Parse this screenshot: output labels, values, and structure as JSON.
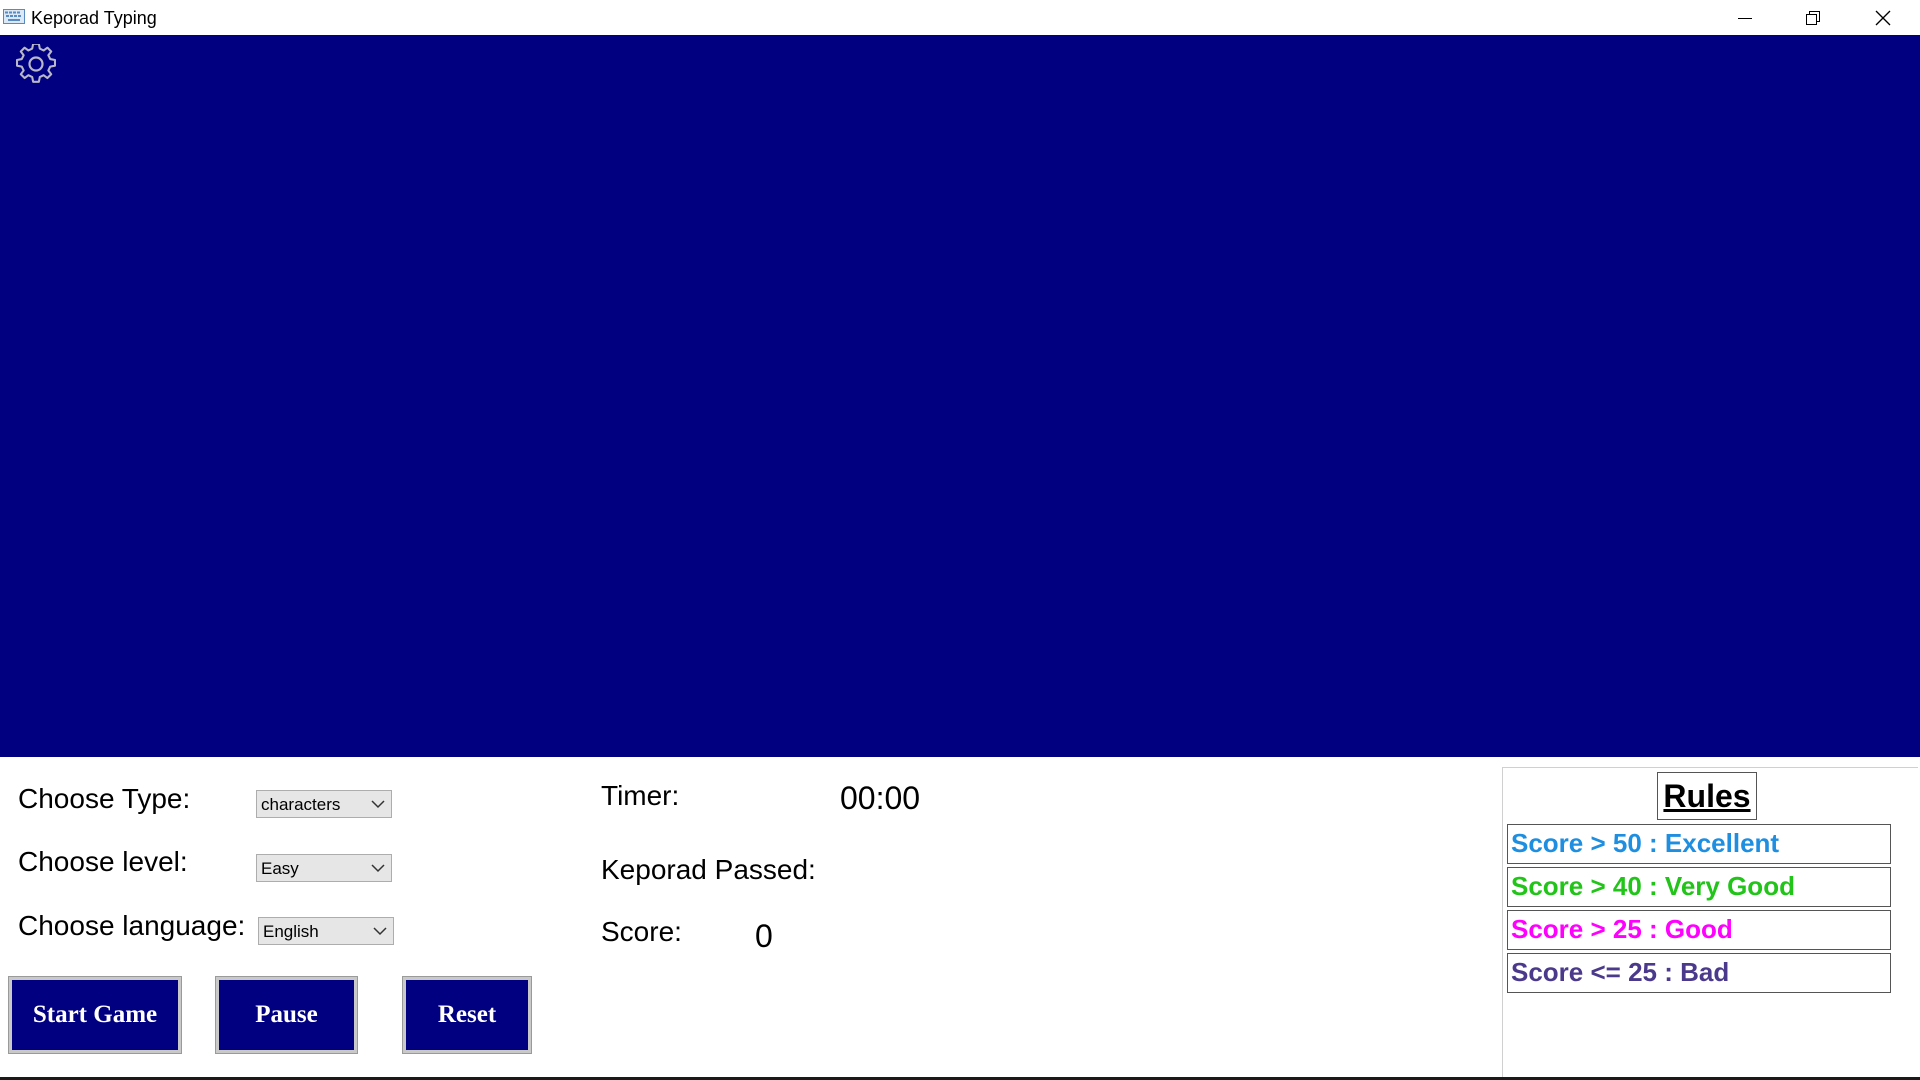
{
  "window": {
    "title": "Keporad Typing",
    "icon": "keyboard-icon"
  },
  "window_controls": {
    "minimize": "minimize-icon",
    "restore": "restore-icon",
    "close": "close-icon"
  },
  "colors": {
    "game_area_bg": "#000080",
    "button_bg": "#000080",
    "rule_excellent": "#1e8ee0",
    "rule_very_good": "#22c41a",
    "rule_good": "#ff00ff",
    "rule_bad": "#4b3a8c"
  },
  "settings": {
    "type_label": "Choose Type:",
    "type_value": "characters",
    "level_label": "Choose level:",
    "level_value": "Easy",
    "language_label": "Choose language:",
    "language_value": "English"
  },
  "buttons": {
    "start": "Start Game",
    "pause": "Pause",
    "reset": "Reset"
  },
  "stats": {
    "timer_label": "Timer:",
    "timer_value": "00:00",
    "passed_label": "Keporad Passed:",
    "passed_value": "",
    "score_label": "Score:",
    "score_value": "0"
  },
  "rules": {
    "title": "Rules",
    "items": [
      "Score > 50 : Excellent",
      "Score > 40 : Very Good",
      "Score > 25 : Good",
      "Score <= 25 : Bad"
    ]
  }
}
